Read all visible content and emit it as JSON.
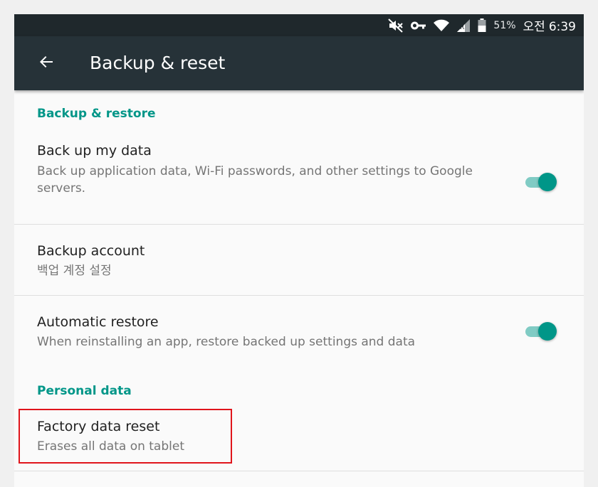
{
  "status_bar": {
    "battery_percent": "51%",
    "time_ampm": "오전",
    "time": "6:39",
    "icons": [
      "mute-icon",
      "vpn-key-icon",
      "wifi-icon",
      "signal-icon",
      "battery-icon"
    ]
  },
  "toolbar": {
    "title": "Backup & reset",
    "back_icon": "arrow-back-icon"
  },
  "sections": {
    "backup_restore": {
      "header": "Backup & restore",
      "backup_my_data": {
        "title": "Back up my data",
        "summary": "Back up application data, Wi-Fi passwords, and other settings to Google servers.",
        "enabled": true
      },
      "backup_account": {
        "title": "Backup account",
        "summary": "백업 계정 설정"
      },
      "automatic_restore": {
        "title": "Automatic restore",
        "summary": "When reinstalling an app, restore backed up settings and data",
        "enabled": true
      }
    },
    "personal_data": {
      "header": "Personal data",
      "factory_reset": {
        "title": "Factory data reset",
        "summary": "Erases all data on tablet"
      }
    }
  },
  "colors": {
    "status_bar": "#1f282c",
    "toolbar": "#263238",
    "accent": "#009688",
    "switch_track": "#80cbc4",
    "highlight_border": "#e0151b"
  }
}
